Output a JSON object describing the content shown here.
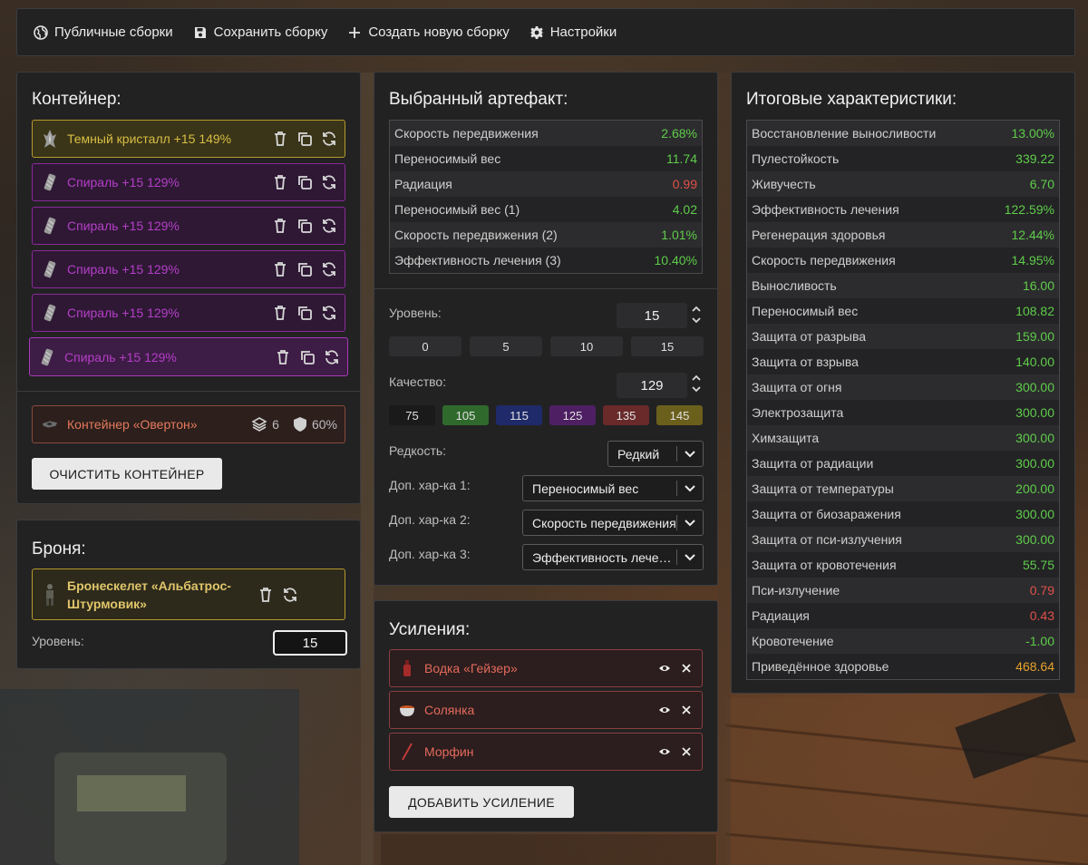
{
  "nav": {
    "public": "Публичные сборки",
    "save": "Сохранить сборку",
    "create": "Создать новую сборку",
    "settings": "Настройки"
  },
  "container": {
    "title": "Контейнер:",
    "slots": [
      {
        "label": "Темный кристалл +15 149%",
        "color": "gold"
      },
      {
        "label": "Спираль +15 129%",
        "color": "purple"
      },
      {
        "label": "Спираль +15 129%",
        "color": "purple"
      },
      {
        "label": "Спираль +15 129%",
        "color": "purple"
      },
      {
        "label": "Спираль +15 129%",
        "color": "purple"
      },
      {
        "label": "Спираль +15 129%",
        "color": "purple"
      }
    ],
    "item": {
      "name": "Контейнер «Овертон»",
      "capacity": "6",
      "protection": "60%"
    },
    "clear_button": "ОЧИСТИТЬ КОНТЕЙНЕР"
  },
  "armor": {
    "title": "Броня:",
    "name": "Бронескелет «Альбатрос-Штурмовик»",
    "level_label": "Уровень:",
    "level_value": "15"
  },
  "artifact": {
    "title": "Выбранный артефакт:",
    "stats": [
      {
        "name": "Скорость передвижения",
        "value": "2.68%",
        "tone": "green"
      },
      {
        "name": "Переносимый вес",
        "value": "11.74",
        "tone": "green"
      },
      {
        "name": "Радиация",
        "value": "0.99",
        "tone": "red"
      },
      {
        "name": "Переносимый вес (1)",
        "value": "4.02",
        "tone": "green"
      },
      {
        "name": "Скорость передвижения (2)",
        "value": "1.01%",
        "tone": "green"
      },
      {
        "name": "Эффективность лечения (3)",
        "value": "10.40%",
        "tone": "green"
      }
    ],
    "level_label": "Уровень:",
    "level_value": "15",
    "level_presets": [
      "0",
      "5",
      "10",
      "15"
    ],
    "quality_label": "Качество:",
    "quality_value": "129",
    "quality_presets": [
      {
        "label": "75",
        "color": "#1a1a1a"
      },
      {
        "label": "105",
        "color": "#2f6a2c"
      },
      {
        "label": "115",
        "color": "#1f2a6a"
      },
      {
        "label": "125",
        "color": "#4e1f63"
      },
      {
        "label": "135",
        "color": "#6a2a2a"
      },
      {
        "label": "145",
        "color": "#6b5f1c"
      }
    ],
    "rarity_label": "Редкость:",
    "rarity_value": "Редкий",
    "extra1_label": "Доп. хар-ка 1:",
    "extra1_value": "Переносимый вес",
    "extra2_label": "Доп. хар-ка 2:",
    "extra2_value": "Скорость передвижения",
    "extra3_label": "Доп. хар-ка 3:",
    "extra3_value": "Эффективность лечения"
  },
  "boosts": {
    "title": "Усиления:",
    "items": [
      {
        "name": "Водка «Гейзер»"
      },
      {
        "name": "Солянка"
      },
      {
        "name": "Морфин"
      }
    ],
    "add_button": "ДОБАВИТЬ УСИЛЕНИЕ"
  },
  "totals": {
    "title": "Итоговые характеристики:",
    "stats": [
      {
        "name": "Восстановление выносливости",
        "value": "13.00%",
        "tone": "green"
      },
      {
        "name": "Пулестойкость",
        "value": "339.22",
        "tone": "green"
      },
      {
        "name": "Живучесть",
        "value": "6.70",
        "tone": "green"
      },
      {
        "name": "Эффективность лечения",
        "value": "122.59%",
        "tone": "green"
      },
      {
        "name": "Регенерация здоровья",
        "value": "12.44%",
        "tone": "green"
      },
      {
        "name": "Скорость передвижения",
        "value": "14.95%",
        "tone": "green"
      },
      {
        "name": "Выносливость",
        "value": "16.00",
        "tone": "green"
      },
      {
        "name": "Переносимый вес",
        "value": "108.82",
        "tone": "green"
      },
      {
        "name": "Защита от разрыва",
        "value": "159.00",
        "tone": "green"
      },
      {
        "name": "Защита от взрыва",
        "value": "140.00",
        "tone": "green"
      },
      {
        "name": "Защита от огня",
        "value": "300.00",
        "tone": "green"
      },
      {
        "name": "Электрозащита",
        "value": "300.00",
        "tone": "green"
      },
      {
        "name": "Химзащита",
        "value": "300.00",
        "tone": "green"
      },
      {
        "name": "Защита от радиации",
        "value": "300.00",
        "tone": "green"
      },
      {
        "name": "Защита от температуры",
        "value": "200.00",
        "tone": "green"
      },
      {
        "name": "Защита от биозаражения",
        "value": "300.00",
        "tone": "green"
      },
      {
        "name": "Защита от пси-излучения",
        "value": "300.00",
        "tone": "green"
      },
      {
        "name": "Защита от кровотечения",
        "value": "55.75",
        "tone": "green"
      },
      {
        "name": "Пси-излучение",
        "value": "0.79",
        "tone": "red"
      },
      {
        "name": "Радиация",
        "value": "0.43",
        "tone": "red"
      },
      {
        "name": "Кровотечение",
        "value": "-1.00",
        "tone": "green"
      },
      {
        "name": "Приведённое здоровье",
        "value": "468.64",
        "tone": "orange"
      }
    ]
  },
  "icons": [
    "globe-icon",
    "save-icon",
    "plus-icon",
    "gear-icon",
    "trash-icon",
    "copy-icon",
    "refresh-icon",
    "layers-icon",
    "shield-icon",
    "eye-icon",
    "close-icon",
    "chevron-down-icon",
    "chevron-up-icon"
  ]
}
